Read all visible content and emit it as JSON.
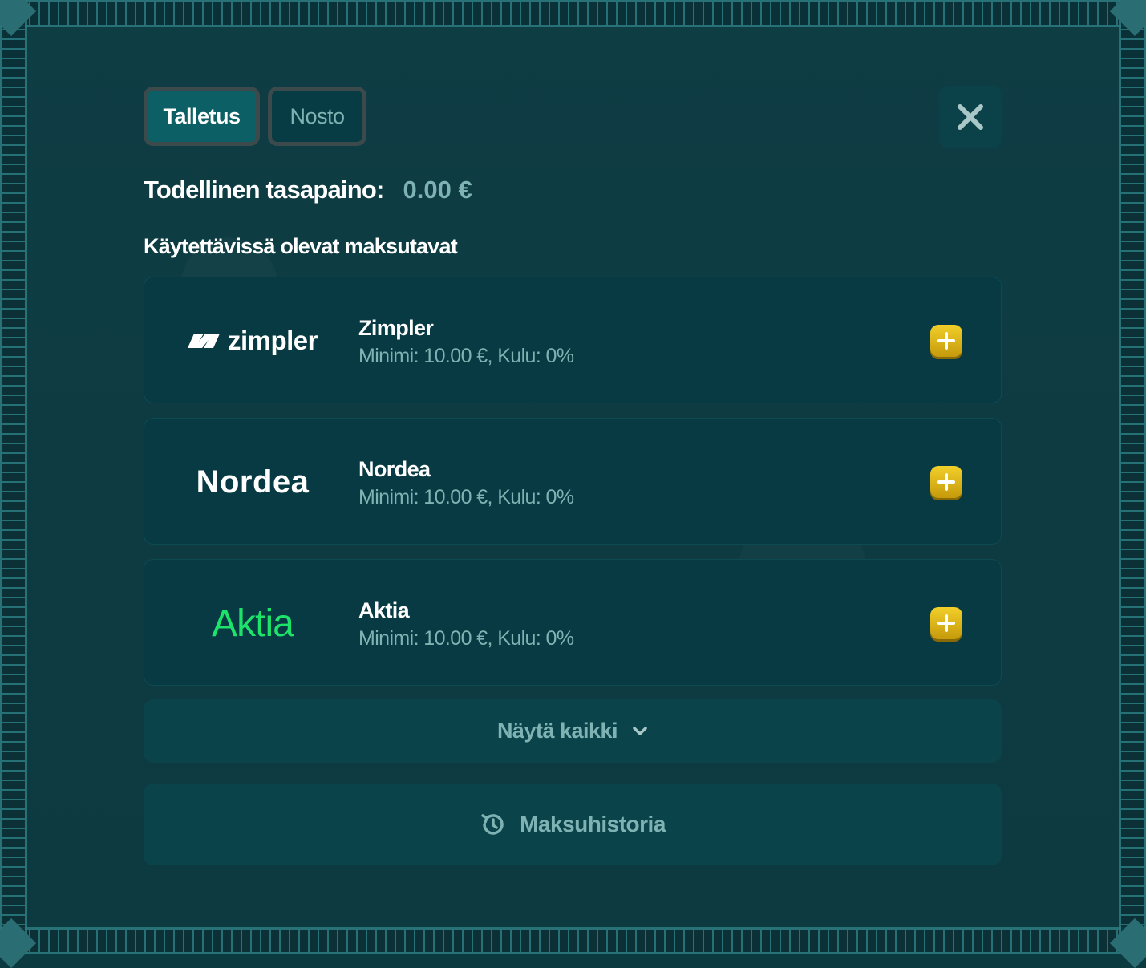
{
  "tabs": {
    "deposit_label": "Talletus",
    "withdraw_label": "Nosto"
  },
  "balance": {
    "label": "Todellinen tasapaino:",
    "value": "0.00 €"
  },
  "section": {
    "title": "Käytettävissä olevat maksutavat"
  },
  "methods": [
    {
      "logo_text": "zimpler",
      "name": "Zimpler",
      "details": "Minimi: 10.00 €, Kulu: 0%"
    },
    {
      "logo_text": "Nordea",
      "name": "Nordea",
      "details": "Minimi: 10.00 €, Kulu: 0%"
    },
    {
      "logo_text": "Aktia",
      "name": "Aktia",
      "details": "Minimi: 10.00 €, Kulu: 0%"
    }
  ],
  "show_all": {
    "label": "Näytä kaikki"
  },
  "history": {
    "label": "Maksuhistoria"
  },
  "icons": {
    "close": "close-icon",
    "add": "plus-icon",
    "expand": "chevron-down-icon",
    "history": "history-icon"
  },
  "colors": {
    "background": "#0d3940",
    "active_tab": "#0c6065",
    "muted_text": "#7fb3b3",
    "add_button": "#e5bd1c",
    "aktia_green": "#1ee36b"
  }
}
